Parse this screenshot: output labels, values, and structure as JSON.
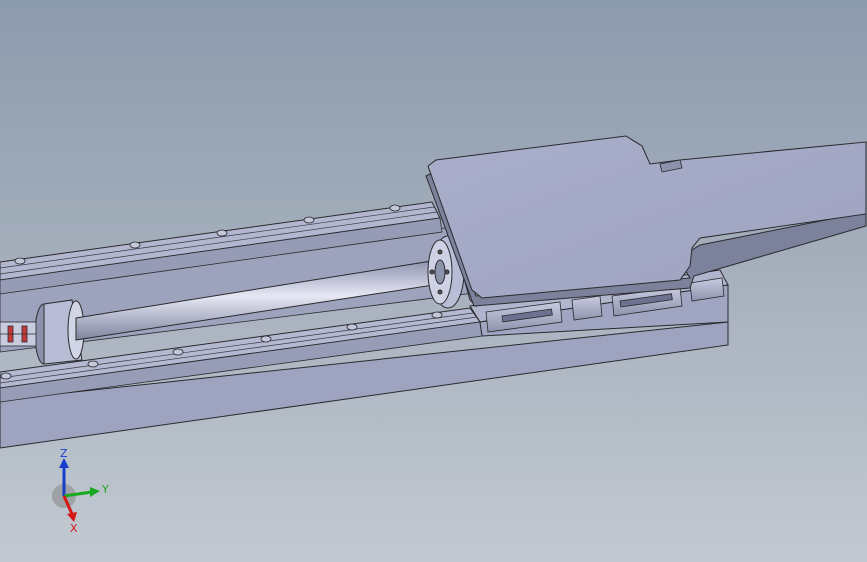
{
  "viewport": {
    "background_top": "#8c9bad",
    "background_bottom": "#c2c9d1"
  },
  "model": {
    "part_color": "#a4a9c4",
    "part_dark": "#7e839c",
    "edge_color": "#2a2a2e"
  },
  "triad": {
    "z_label": "Z",
    "y_label": "Y",
    "x_label": "X",
    "z_color": "#1a3ccc",
    "y_color": "#18a81e",
    "x_color": "#d41818"
  }
}
